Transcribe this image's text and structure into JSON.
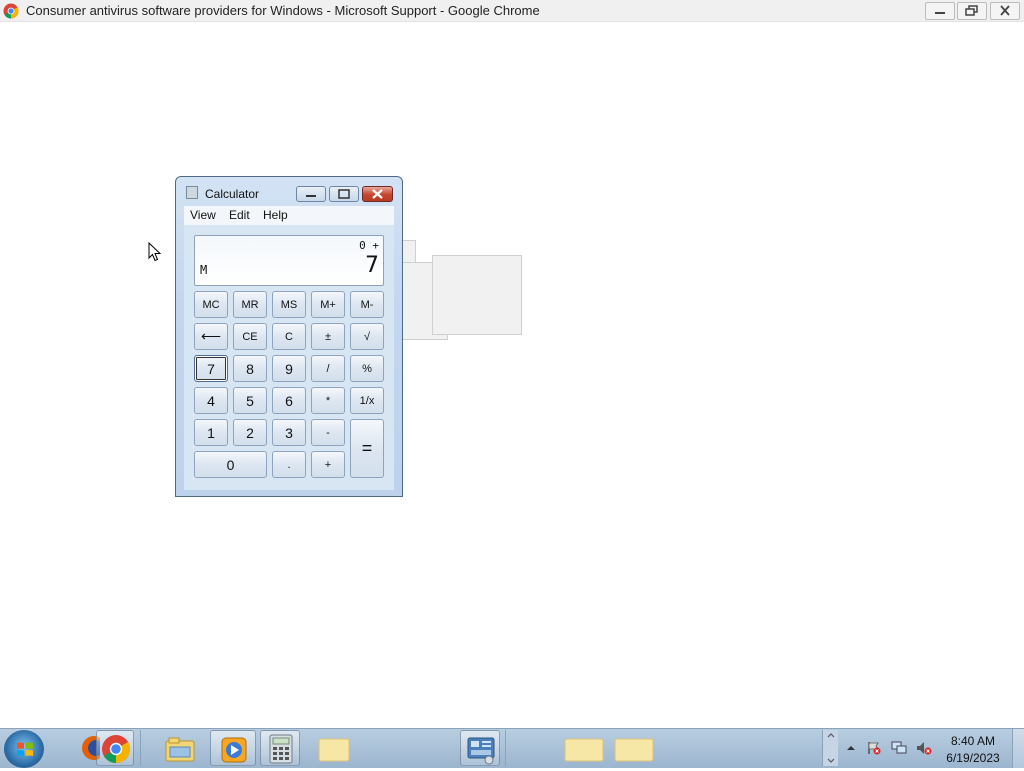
{
  "chrome": {
    "title": "Consumer antivirus software providers for Windows - Microsoft Support - Google Chrome"
  },
  "calculator": {
    "title": "Calculator",
    "menu": [
      "View",
      "Edit",
      "Help"
    ],
    "display": {
      "expression": "0 +",
      "memory_indicator": "M",
      "value": "7"
    },
    "keys": {
      "row1": [
        "MC",
        "MR",
        "MS",
        "M+",
        "M-"
      ],
      "row2": [
        "⟵",
        "CE",
        "C",
        "±",
        "√"
      ],
      "row3": [
        "7",
        "8",
        "9",
        "/",
        "%"
      ],
      "row4": [
        "4",
        "5",
        "6",
        "*",
        "1/x"
      ],
      "row5": [
        "1",
        "2",
        "3",
        "-"
      ],
      "row6": [
        "0",
        ".",
        "+"
      ],
      "equals": "="
    },
    "focused_key": "7"
  },
  "taskbar": {
    "items": [
      "start-button",
      "firefox",
      "chrome",
      "file-explorer",
      "media-player",
      "calculator",
      "folder",
      "control-panel",
      "folder",
      "folder"
    ],
    "clock": {
      "time": "8:40 AM",
      "date": "6/19/2023"
    }
  },
  "colors": {
    "calc_frame": "#c3d6ee",
    "close_button": "#c6452f",
    "taskbar": "#b8cde0"
  }
}
